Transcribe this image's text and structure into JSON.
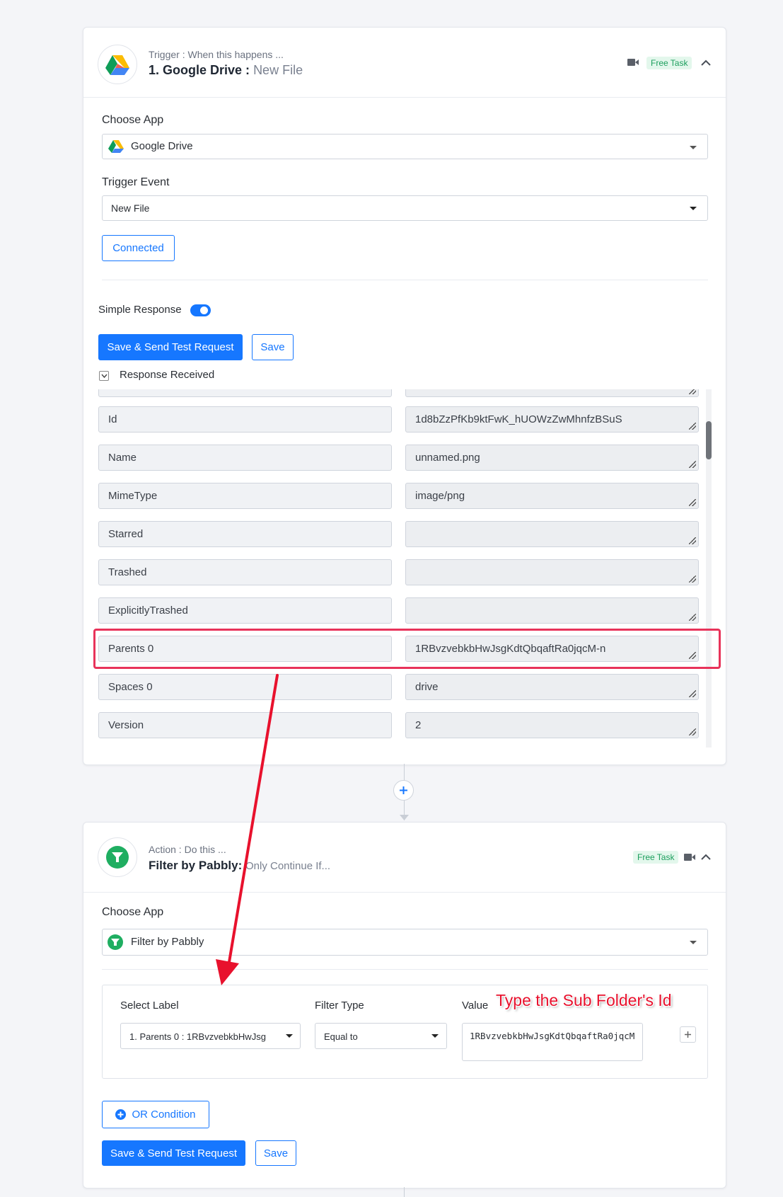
{
  "trigger": {
    "subtitle": "Trigger : When this happens ...",
    "title_main": "1. Google Drive :",
    "title_event": "New File",
    "badge": "Free Task",
    "choose_app_label": "Choose App",
    "app_value": "Google Drive",
    "trigger_event_label": "Trigger Event",
    "event_value": "New File",
    "connected_label": "Connected",
    "simple_response_label": "Simple Response",
    "save_send_label": "Save & Send Test Request",
    "save_label": "Save",
    "response_received_label": "Response Received",
    "rows": [
      {
        "key": "Id",
        "value": "1d8bZzPfKb9ktFwK_hUOWzZwMhnfzBSuS"
      },
      {
        "key": "Name",
        "value": "unnamed.png"
      },
      {
        "key": "MimeType",
        "value": "image/png"
      },
      {
        "key": "Starred",
        "value": ""
      },
      {
        "key": "Trashed",
        "value": ""
      },
      {
        "key": "ExplicitlyTrashed",
        "value": ""
      },
      {
        "key": "Parents 0",
        "value": "1RBvzvebkbHwJsgKdtQbqaftRa0jqcM-n"
      },
      {
        "key": "Spaces 0",
        "value": "drive"
      },
      {
        "key": "Version",
        "value": "2"
      }
    ]
  },
  "action": {
    "subtitle": "Action : Do this ...",
    "title_main": "Filter by Pabbly:",
    "title_event": "Only Continue If...",
    "badge": "Free Task",
    "choose_app_label": "Choose App",
    "app_value": "Filter by Pabbly",
    "select_label_heading": "Select Label",
    "filter_type_heading": "Filter Type",
    "value_heading": "Value",
    "select_label_value": "1. Parents 0 : 1RBvzvebkbHwJsg",
    "filter_type_value": "Equal to",
    "value_text": "1RBvzvebkbHwJsgKdtQbqaftRa0jqcM",
    "or_condition_label": "OR Condition",
    "save_send_label": "Save & Send Test Request",
    "save_label": "Save"
  },
  "annotation": {
    "text": "Type the Sub Folder's Id",
    "color": "#e8112d"
  },
  "colors": {
    "primary": "#1677ff",
    "badge_green": "#1c9f5d",
    "highlight": "#e8335a"
  }
}
